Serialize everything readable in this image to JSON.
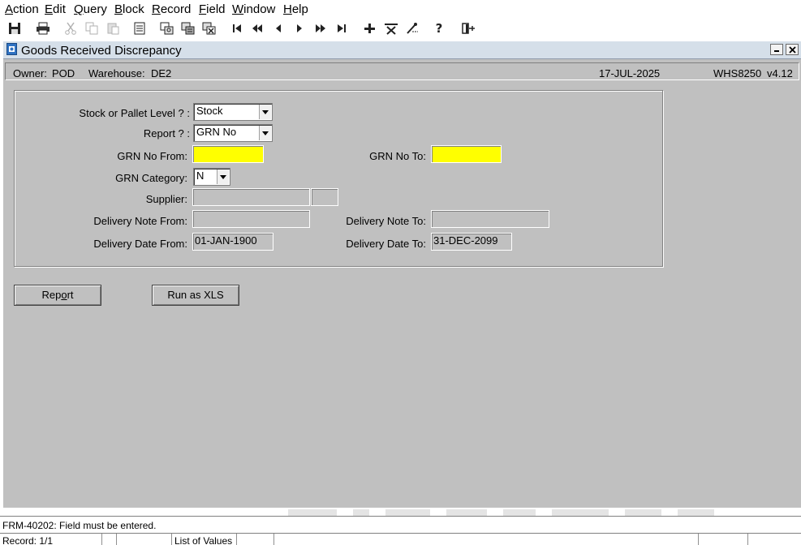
{
  "menu": [
    {
      "accel": "A",
      "rest": "ction"
    },
    {
      "accel": "E",
      "rest": "dit"
    },
    {
      "accel": "Q",
      "rest": "uery"
    },
    {
      "accel": "B",
      "rest": "lock"
    },
    {
      "accel": "R",
      "rest": "ecord"
    },
    {
      "accel": "F",
      "rest": "ield"
    },
    {
      "accel": "W",
      "rest": "indow"
    },
    {
      "accel": "H",
      "rest": "elp"
    }
  ],
  "window": {
    "title": "Goods Received Discrepancy"
  },
  "header": {
    "owner_label": "Owner:",
    "owner": "POD",
    "warehouse_label": "Warehouse:",
    "warehouse": "DE2",
    "date": "17-JUL-2025",
    "module": "WHS8250",
    "version": "v4.12"
  },
  "form": {
    "stock_pallet_label": "Stock or Pallet Level ? :",
    "stock_pallet_value": "Stock",
    "report_label": "Report ? :",
    "report_value": "GRN No",
    "grn_from_label": "GRN No From:",
    "grn_from_value": "",
    "grn_to_label": "GRN No To:",
    "grn_to_value": "",
    "grn_category_label": "GRN Category:",
    "grn_category_value": "N",
    "supplier_label": "Supplier:",
    "supplier_value": "",
    "supplier_code": "",
    "delivery_note_from_label": "Delivery Note From:",
    "delivery_note_from_value": "",
    "delivery_note_to_label": "Delivery Note To:",
    "delivery_note_to_value": "",
    "delivery_date_from_label": "Delivery Date From:",
    "delivery_date_from_value": "01-JAN-1900",
    "delivery_date_to_label": "Delivery Date To:",
    "delivery_date_to_value": "31-DEC-2099"
  },
  "buttons": {
    "report_pre": "Rep",
    "report_accel": "o",
    "report_post": "rt",
    "run_xls": "Run as XLS"
  },
  "message": "FRM-40202:  Field must be entered.",
  "status": {
    "record": "Record: 1/1",
    "list_of_values": "List of Values"
  },
  "colors": {
    "background": "#c0c0c0",
    "required_field": "#ffff00",
    "titlebar": "#d5dfe9"
  }
}
